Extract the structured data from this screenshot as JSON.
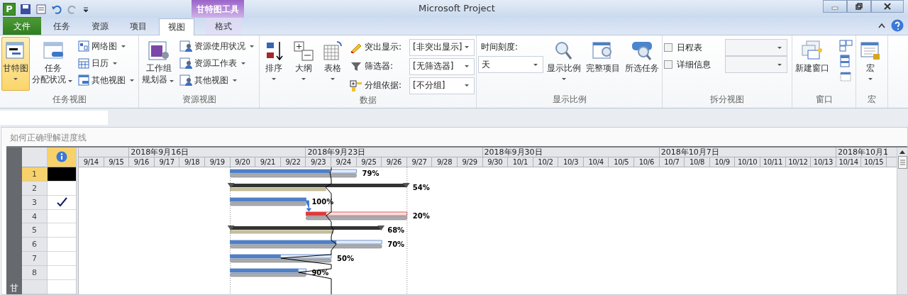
{
  "title_bar": {
    "logo": "P",
    "title": "Microsoft Project",
    "context_tab_group": "甘特图工具"
  },
  "tabs": [
    {
      "label": "文件",
      "kind": "file",
      "selected": false
    },
    {
      "label": "任务",
      "kind": "normal",
      "selected": false
    },
    {
      "label": "资源",
      "kind": "normal",
      "selected": false
    },
    {
      "label": "项目",
      "kind": "normal",
      "selected": false
    },
    {
      "label": "视图",
      "kind": "normal",
      "selected": true
    },
    {
      "label": "格式",
      "kind": "context",
      "selected": false
    }
  ],
  "ribbon_groups": [
    {
      "label": "任务视图",
      "items": [
        {
          "kind": "large",
          "lines": [
            "甘特图"
          ],
          "selected": true,
          "dropdown": true
        },
        {
          "kind": "large",
          "lines": [
            "任务",
            "分配状况"
          ],
          "selected": false,
          "dropdown": true
        },
        {
          "kind": "stack",
          "items": [
            {
              "label": "网络图",
              "dropdown": true
            },
            {
              "label": "日历",
              "dropdown": true
            },
            {
              "label": "其他视图",
              "dropdown": true
            }
          ]
        }
      ]
    },
    {
      "label": "资源视图",
      "items": [
        {
          "kind": "large",
          "lines": [
            "工作组",
            "规划器"
          ],
          "selected": false,
          "dropdown": true
        },
        {
          "kind": "stack",
          "items": [
            {
              "label": "资源使用状况",
              "dropdown": true
            },
            {
              "label": "资源工作表",
              "dropdown": true
            },
            {
              "label": "其他视图",
              "dropdown": true
            }
          ]
        }
      ]
    },
    {
      "label": "数据",
      "items": [
        {
          "kind": "large",
          "lines": [
            "排序"
          ],
          "selected": false,
          "dropdown": true
        },
        {
          "kind": "large",
          "lines": [
            "大纲"
          ],
          "selected": false,
          "dropdown": true
        },
        {
          "kind": "large",
          "lines": [
            "表格"
          ],
          "selected": false,
          "dropdown": true
        },
        {
          "kind": "fields",
          "items": [
            {
              "label": "突出显示:",
              "value": "[非突出显示]"
            },
            {
              "label": "筛选器:",
              "value": "[无筛选器]"
            },
            {
              "label": "分组依据:",
              "value": "[不分组]"
            }
          ]
        }
      ]
    },
    {
      "label": "显示比例",
      "items": [
        {
          "kind": "combo",
          "label": "时间刻度:",
          "value": "天"
        },
        {
          "kind": "large",
          "lines": [
            "显示比例"
          ],
          "selected": false,
          "dropdown": true
        },
        {
          "kind": "large",
          "lines": [
            "完整项目"
          ],
          "selected": false,
          "dropdown": false
        },
        {
          "kind": "large",
          "lines": [
            "所选任务"
          ],
          "selected": false,
          "dropdown": false
        }
      ]
    },
    {
      "label": "拆分视图",
      "items": [
        {
          "kind": "checks",
          "items": [
            {
              "label": "日程表",
              "checked": false
            },
            {
              "label": "详细信息",
              "checked": false
            }
          ]
        }
      ]
    },
    {
      "label": "窗口",
      "items": [
        {
          "kind": "large",
          "lines": [
            "新建窗口"
          ],
          "selected": false,
          "dropdown": false
        },
        {
          "kind": "icons"
        }
      ]
    },
    {
      "label": "宏",
      "items": [
        {
          "kind": "large",
          "lines": [
            "宏"
          ],
          "selected": false,
          "dropdown": true
        }
      ]
    }
  ],
  "gantt": {
    "title": "如何正确理解进度线",
    "side_label": "甘",
    "weeks": [
      "2018年9月16日",
      "2018年9月23日",
      "2018年9月30日",
      "2018年10月7日",
      "2018年10月1"
    ],
    "days": [
      "9/14",
      "9/15",
      "9/16",
      "9/17",
      "9/18",
      "9/19",
      "9/20",
      "9/21",
      "9/22",
      "9/23",
      "9/24",
      "9/25",
      "9/26",
      "9/27",
      "9/28",
      "9/29",
      "9/30",
      "10/1",
      "10/2",
      "10/3",
      "10/4",
      "10/5",
      "10/6",
      "10/7",
      "10/8",
      "10/9",
      "10/10",
      "10/11",
      "10/12",
      "10/13",
      "10/14",
      "10/15"
    ],
    "rows": [
      {
        "id": "1",
        "selected": true,
        "complete": false,
        "kind": "task",
        "level": 0.79,
        "percent": "79%",
        "link_from_previous": false
      },
      {
        "id": "2",
        "selected": false,
        "complete": false,
        "kind": "summary",
        "level": 0.54,
        "percent": "54%",
        "link_from_previous": false
      },
      {
        "id": "3",
        "selected": false,
        "complete": true,
        "kind": "task",
        "level": 1,
        "percent": "100%",
        "link_from_previous": false
      },
      {
        "id": "4",
        "selected": false,
        "complete": false,
        "kind": "critical",
        "level": 0.2,
        "percent": "20%",
        "link_from_previous": true
      },
      {
        "id": "5",
        "selected": false,
        "complete": false,
        "kind": "summary",
        "level": 0.68,
        "percent": "68%",
        "link_from_previous": false
      },
      {
        "id": "6",
        "selected": false,
        "complete": false,
        "kind": "task",
        "level": 0.7,
        "percent": "70%",
        "link_from_previous": false
      },
      {
        "id": "7",
        "selected": false,
        "complete": false,
        "kind": "task",
        "level": 0.5,
        "percent": "50%",
        "link_from_previous": false
      },
      {
        "id": "8",
        "selected": false,
        "complete": false,
        "kind": "task",
        "level": 0.9,
        "percent": "90%",
        "link_from_previous": false
      }
    ]
  }
}
